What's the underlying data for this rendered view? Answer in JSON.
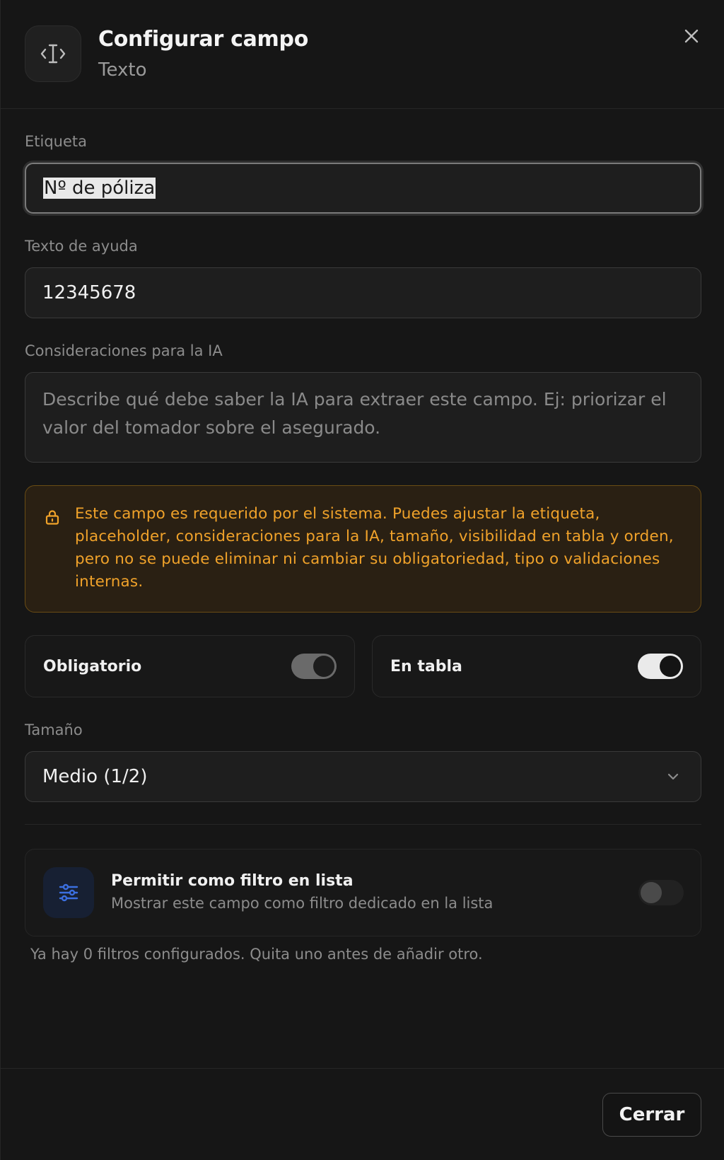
{
  "header": {
    "title": "Configurar campo",
    "subtitle": "Texto",
    "icon": "text-cursor-icon",
    "close_icon": "close-icon"
  },
  "fields": {
    "label": {
      "label": "Etiqueta",
      "value": "Nº de póliza"
    },
    "help_text": {
      "label": "Texto de ayuda",
      "value": "12345678"
    },
    "ai_considerations": {
      "label": "Consideraciones para la IA",
      "placeholder": "Describe qué debe saber la IA para extraer este campo. Ej: priorizar el valor del tomador sobre el asegurado."
    }
  },
  "warning": {
    "icon": "lock-icon",
    "text": "Este campo es requerido por el sistema. Puedes ajustar la etiqueta, placeholder, consideraciones para la IA, tamaño, visibilidad en tabla y orden, pero no se puede eliminar ni cambiar su obligatoriedad, tipo o validaciones internas.",
    "color": "#f0a22a"
  },
  "toggles": {
    "required": {
      "label": "Obligatorio",
      "on": true,
      "disabled": true
    },
    "in_table": {
      "label": "En tabla",
      "on": true,
      "disabled": false
    }
  },
  "size": {
    "label": "Tamaño",
    "value": "Medio (1/2)"
  },
  "filter": {
    "icon": "sliders-icon",
    "title": "Permitir como filtro en lista",
    "description": "Mostrar este campo como filtro dedicado en la lista",
    "on": false,
    "hint": "Ya hay 0 filtros configurados. Quita uno antes de añadir otro."
  },
  "footer": {
    "close_label": "Cerrar"
  },
  "colors": {
    "background": "#161616",
    "accent_blue": "#3b6fe0",
    "warning": "#f0a22a"
  }
}
